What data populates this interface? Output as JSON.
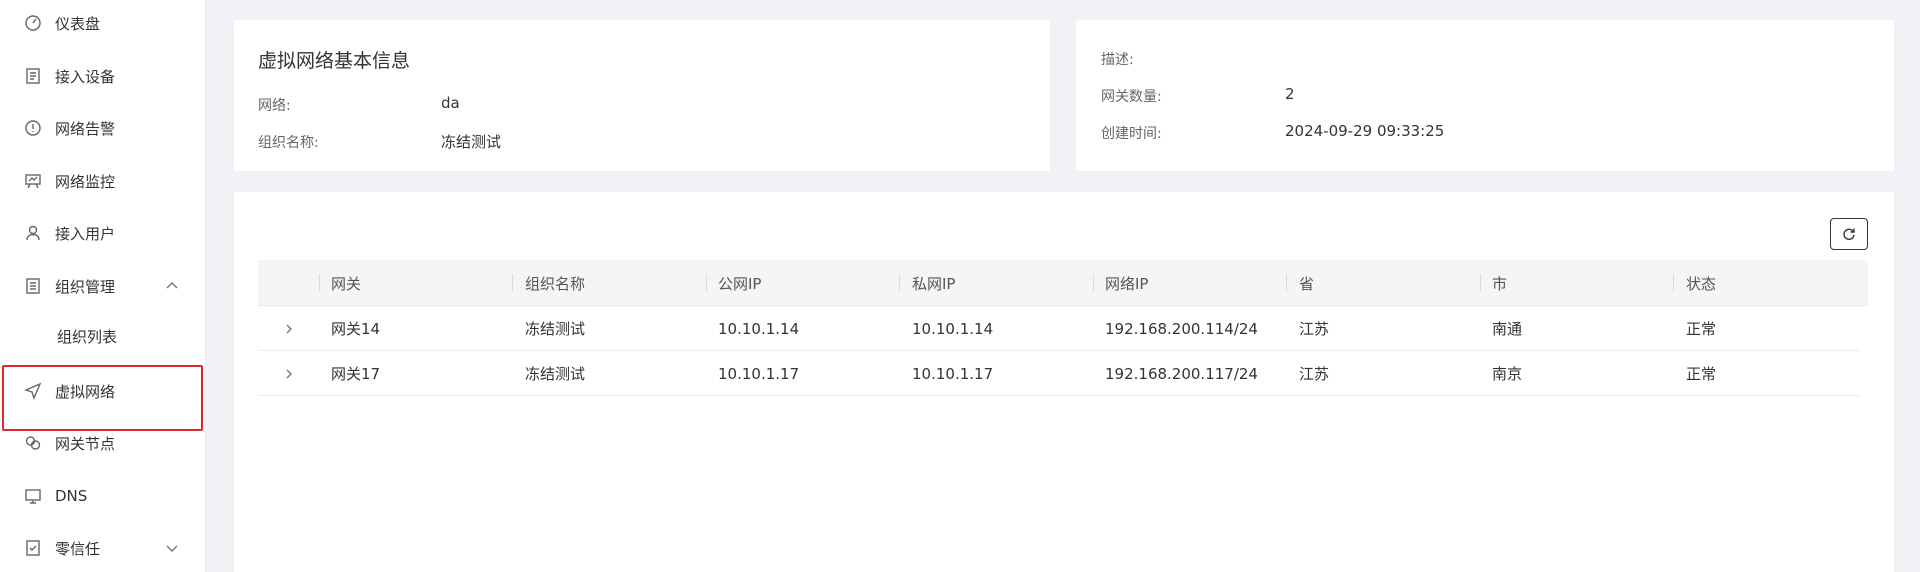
{
  "sidebar": {
    "items": [
      {
        "label": "仪表盘",
        "icon": "gauge-icon"
      },
      {
        "label": "接入设备",
        "icon": "device-list-icon"
      },
      {
        "label": "网络告警",
        "icon": "alert-circle-icon"
      },
      {
        "label": "网络监控",
        "icon": "monitor-board-icon"
      },
      {
        "label": "接入用户",
        "icon": "user-icon"
      },
      {
        "label": "组织管理",
        "icon": "org-doc-icon"
      },
      {
        "label": "组织列表"
      },
      {
        "label": "虚拟网络",
        "icon": "send-arrow-icon"
      },
      {
        "label": "网关节点",
        "icon": "link-nodes-icon"
      },
      {
        "label": "DNS",
        "icon": "desktop-icon"
      },
      {
        "label": "零信任",
        "icon": "shield-doc-icon"
      }
    ],
    "active": "虚拟网络",
    "highlight_color": "#e0262b"
  },
  "basic_info": {
    "title": "虚拟网络基本信息",
    "network_label": "网络:",
    "network_value": "da",
    "org_label": "组织名称:",
    "org_value": "冻结测试"
  },
  "details": {
    "desc_label": "描述:",
    "desc_value": "",
    "gateway_count_label": "网关数量:",
    "gateway_count_value": "2",
    "created_label": "创建时间:",
    "created_value": "2024-09-29 09:33:25"
  },
  "table": {
    "columns": [
      "网关",
      "组织名称",
      "公网IP",
      "私网IP",
      "网络IP",
      "省",
      "市",
      "状态"
    ],
    "rows": [
      [
        "网关14",
        "冻结测试",
        "10.10.1.14",
        "10.10.1.14",
        "192.168.200.114/24",
        "江苏",
        "南通",
        "正常"
      ],
      [
        "网关17",
        "冻结测试",
        "10.10.1.17",
        "10.10.1.17",
        "192.168.200.117/24",
        "江苏",
        "南京",
        "正常"
      ]
    ]
  }
}
